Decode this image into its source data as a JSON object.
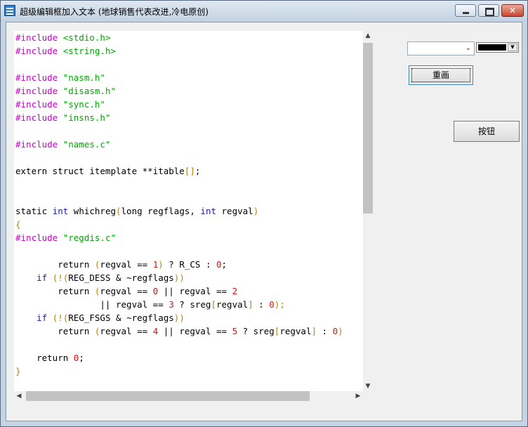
{
  "window": {
    "title": "超级编辑框加入文本 (地球销售代表改进,冷电原创)",
    "close_glyph": "✕"
  },
  "colors": {
    "preprocessor": "#c800c8",
    "keyword": "#1a1aa6",
    "string": "#00a800",
    "number": "#e01010",
    "bracket": "#b8860b",
    "text": "#000000"
  },
  "editor": {
    "lines": [
      [
        {
          "t": "#include ",
          "c": "preprocessor"
        },
        {
          "t": "<stdio.h>",
          "c": "string"
        }
      ],
      [
        {
          "t": "#include ",
          "c": "preprocessor"
        },
        {
          "t": "<string.h>",
          "c": "string"
        }
      ],
      [],
      [
        {
          "t": "#include ",
          "c": "preprocessor"
        },
        {
          "t": "\"nasm.h\"",
          "c": "string"
        }
      ],
      [
        {
          "t": "#include ",
          "c": "preprocessor"
        },
        {
          "t": "\"disasm.h\"",
          "c": "string"
        }
      ],
      [
        {
          "t": "#include ",
          "c": "preprocessor"
        },
        {
          "t": "\"sync.h\"",
          "c": "string"
        }
      ],
      [
        {
          "t": "#include ",
          "c": "preprocessor"
        },
        {
          "t": "\"insns.h\"",
          "c": "string"
        }
      ],
      [],
      [
        {
          "t": "#include ",
          "c": "preprocessor"
        },
        {
          "t": "\"names.c\"",
          "c": "string"
        }
      ],
      [],
      [
        {
          "t": "extern struct itemplate **itable",
          "c": "text"
        },
        {
          "t": "[]",
          "c": "bracket"
        },
        {
          "t": ";",
          "c": "text"
        }
      ],
      [],
      [],
      [
        {
          "t": "static ",
          "c": "text"
        },
        {
          "t": "int",
          "c": "keyword"
        },
        {
          "t": " whichreg",
          "c": "text"
        },
        {
          "t": "(",
          "c": "bracket"
        },
        {
          "t": "long regflags, ",
          "c": "text"
        },
        {
          "t": "int",
          "c": "keyword"
        },
        {
          "t": " regval",
          "c": "text"
        },
        {
          "t": ")",
          "c": "bracket"
        }
      ],
      [
        {
          "t": "{",
          "c": "bracket"
        }
      ],
      [
        {
          "t": "#include ",
          "c": "preprocessor"
        },
        {
          "t": "\"regdis.c\"",
          "c": "string"
        }
      ],
      [],
      [
        {
          "t": "        return ",
          "c": "text"
        },
        {
          "t": "(",
          "c": "bracket"
        },
        {
          "t": "regval == ",
          "c": "text"
        },
        {
          "t": "1",
          "c": "number"
        },
        {
          "t": ")",
          "c": "bracket"
        },
        {
          "t": " ? R_CS : ",
          "c": "text"
        },
        {
          "t": "0",
          "c": "number"
        },
        {
          "t": ";",
          "c": "text"
        }
      ],
      [
        {
          "t": "    ",
          "c": "text"
        },
        {
          "t": "if",
          "c": "keyword"
        },
        {
          "t": " ",
          "c": "text"
        },
        {
          "t": "(!(",
          "c": "bracket"
        },
        {
          "t": "REG_DESS & ~regflags",
          "c": "text"
        },
        {
          "t": "))",
          "c": "bracket"
        }
      ],
      [
        {
          "t": "        return ",
          "c": "text"
        },
        {
          "t": "(",
          "c": "bracket"
        },
        {
          "t": "regval == ",
          "c": "text"
        },
        {
          "t": "0",
          "c": "number"
        },
        {
          "t": " || regval == ",
          "c": "text"
        },
        {
          "t": "2",
          "c": "number"
        }
      ],
      [
        {
          "t": "                || regval == ",
          "c": "text"
        },
        {
          "t": "3",
          "c": "number"
        },
        {
          "t": " ? sreg",
          "c": "text"
        },
        {
          "t": "[",
          "c": "bracket"
        },
        {
          "t": "regval",
          "c": "text"
        },
        {
          "t": "]",
          "c": "bracket"
        },
        {
          "t": " : ",
          "c": "text"
        },
        {
          "t": "0",
          "c": "number"
        },
        {
          "t": ");",
          "c": "bracket"
        }
      ],
      [
        {
          "t": "    ",
          "c": "text"
        },
        {
          "t": "if",
          "c": "keyword"
        },
        {
          "t": " ",
          "c": "text"
        },
        {
          "t": "(!(",
          "c": "bracket"
        },
        {
          "t": "REG_FSGS & ~regflags",
          "c": "text"
        },
        {
          "t": "))",
          "c": "bracket"
        }
      ],
      [
        {
          "t": "        return ",
          "c": "text"
        },
        {
          "t": "(",
          "c": "bracket"
        },
        {
          "t": "regval == ",
          "c": "text"
        },
        {
          "t": "4",
          "c": "number"
        },
        {
          "t": " || regval == ",
          "c": "text"
        },
        {
          "t": "5",
          "c": "number"
        },
        {
          "t": " ? sreg",
          "c": "text"
        },
        {
          "t": "[",
          "c": "bracket"
        },
        {
          "t": "regval",
          "c": "text"
        },
        {
          "t": "]",
          "c": "bracket"
        },
        {
          "t": " : ",
          "c": "text"
        },
        {
          "t": "0",
          "c": "number"
        },
        {
          "t": ")",
          "c": "bracket"
        }
      ],
      [],
      [
        {
          "t": "    return ",
          "c": "text"
        },
        {
          "t": "0",
          "c": "number"
        },
        {
          "t": ";",
          "c": "text"
        }
      ],
      [
        {
          "t": "}",
          "c": "bracket"
        }
      ]
    ]
  },
  "scrollbars": {
    "up_glyph": "▲",
    "down_glyph": "▼",
    "left_glyph": "◀",
    "right_glyph": "▶"
  },
  "controls": {
    "font_combo_value": "",
    "font_combo_chevron": "⌄",
    "color_combo_value": "#000000",
    "color_combo_arrow": "▼",
    "redraw_label": "重画",
    "ok_label": "按钮"
  }
}
